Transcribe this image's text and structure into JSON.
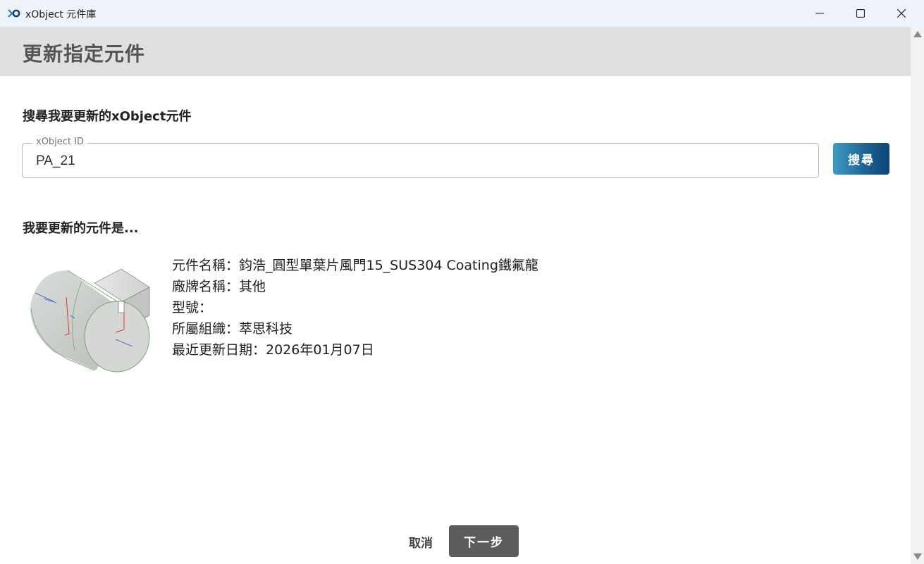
{
  "window": {
    "title": "xObject 元件庫",
    "icon": "xobject-logo-icon",
    "controls": [
      "minimize-icon",
      "maximize-icon",
      "close-icon"
    ]
  },
  "header": {
    "title": "更新指定元件"
  },
  "search": {
    "section_title": "搜尋我要更新的xObject元件",
    "field_label": "xObject ID",
    "field_value": "PA_21",
    "button_label": "搜尋"
  },
  "result": {
    "section_title": "我要更新的元件是...",
    "thumbnail_icon": "cylinder-model-icon",
    "lines": [
      "元件名稱：鈞浩_圓型單葉片風門15_SUS304 Coating鐵氟龍",
      "廠牌名稱：其他",
      "型號：",
      "所屬組織：萃思科技",
      "最近更新日期：2026年01月07日"
    ]
  },
  "footer": {
    "cancel_label": "取消",
    "next_label": "下一步"
  },
  "colors": {
    "titlebar": "#eef3f9",
    "header_band": "#e0e0e0",
    "search_button_start": "#3d9bc4",
    "search_button_end": "#0d4574",
    "next_button": "#5c5c5c"
  }
}
